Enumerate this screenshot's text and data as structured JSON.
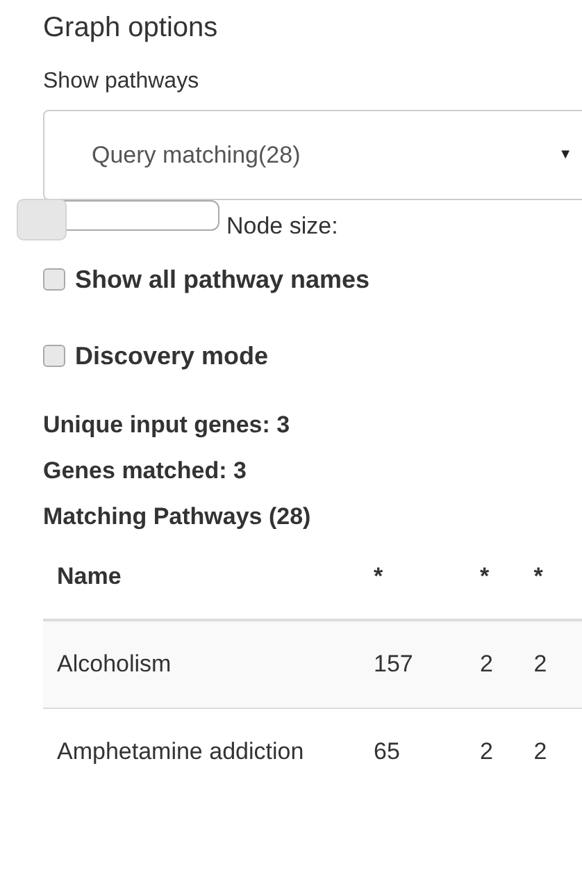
{
  "title": "Graph options",
  "show_pathways": {
    "label": "Show pathways",
    "value": "Query matching(28)",
    "arrow": "▼"
  },
  "node_size": {
    "label": "Node size:",
    "level": 0
  },
  "checkboxes": [
    {
      "label": "Show all pathway names",
      "checked": false
    },
    {
      "label": "Discovery mode",
      "checked": false
    }
  ],
  "stats": [
    "Unique input genes: 3",
    "Genes matched: 3",
    "Matching Pathways (28)"
  ],
  "table": {
    "columns": [
      "Name",
      "*",
      "*",
      "*"
    ],
    "rows": [
      [
        "Alcoholism",
        "157",
        "2",
        "2"
      ],
      [
        "Amphetamine addiction",
        "65",
        "2",
        "2"
      ]
    ]
  }
}
